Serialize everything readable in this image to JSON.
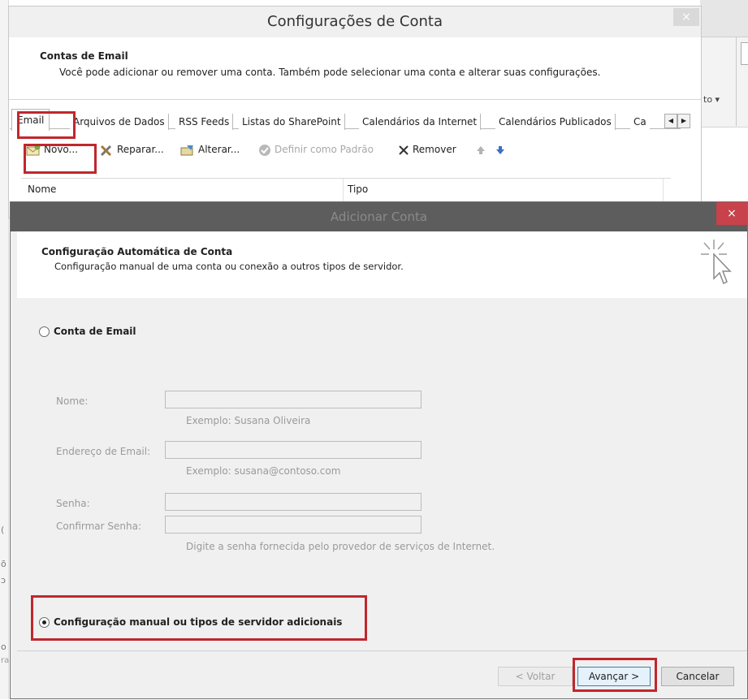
{
  "background": {
    "right_text": "to ▾",
    "left_fragments": [
      "(",
      "õ",
      "ɔ",
      "o",
      "ra"
    ]
  },
  "account_settings": {
    "title": "Configurações de Conta",
    "close_glyph": "×",
    "header_title": "Contas de Email",
    "header_desc": "Você pode adicionar ou remover uma conta. Também pode selecionar uma conta e alterar suas configurações.",
    "tabs": [
      "Email",
      "Arquivos de Dados",
      "RSS Feeds",
      "Listas do SharePoint",
      "Calendários da Internet",
      "Calendários Publicados",
      "Ca"
    ],
    "toolbar": {
      "new": "Novo...",
      "repair": "Reparar...",
      "change": "Alterar...",
      "set_default": "Definir como Padrão",
      "remove": "Remover"
    },
    "columns": {
      "name": "Nome",
      "type": "Tipo"
    }
  },
  "add_account": {
    "title": "Adicionar Conta",
    "close_glyph": "×",
    "header_title": "Configuração Automática de Conta",
    "header_desc": "Configuração manual de uma conta ou conexão a outros tipos de servidor.",
    "option_email": "Conta de Email",
    "fields": {
      "name_label": "Nome:",
      "name_hint": "Exemplo: Susana Oliveira",
      "email_label": "Endereço de Email:",
      "email_hint": "Exemplo: susana@contoso.com",
      "password_label": "Senha:",
      "confirm_label": "Confirmar Senha:",
      "password_hint": "Digite a senha fornecida pelo provedor de serviços de Internet."
    },
    "option_manual": "Configuração manual ou tipos de servidor adicionais",
    "buttons": {
      "back": "< Voltar",
      "next": "Avançar >",
      "cancel": "Cancelar"
    }
  },
  "colors": {
    "highlight": "#c0272d",
    "dialog_titlebar": "#5d5d5d",
    "close_red": "#c7424a"
  }
}
